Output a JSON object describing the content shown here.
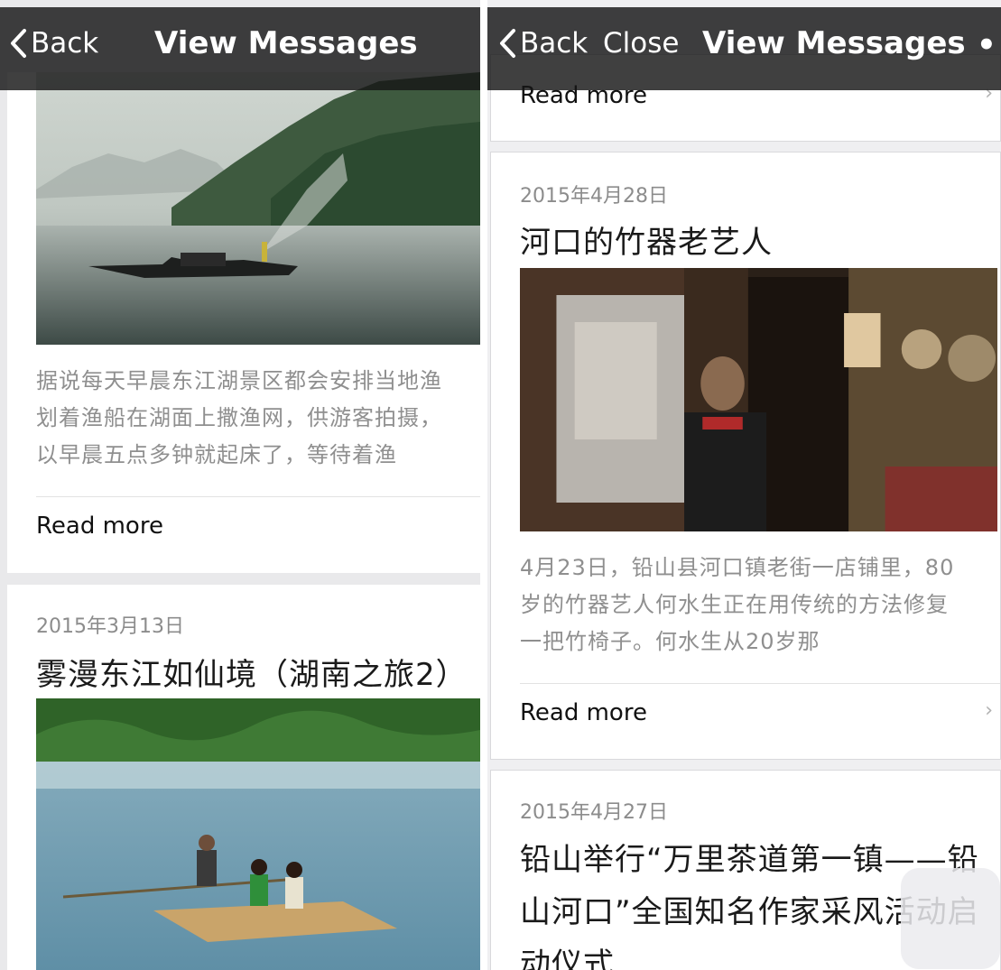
{
  "left": {
    "nav": {
      "back": "Back",
      "title": "View Messages"
    },
    "post1": {
      "excerpt": [
        "据说每天早晨东江湖景区都会安排当地渔",
        "划着渔船在湖面上撒渔网，供游客拍摄，",
        "以早晨五点多钟就起床了，等待着渔"
      ],
      "read_more": "Read more"
    },
    "post2": {
      "date": "2015年3月13日",
      "title": "雾漫东江如仙境（湖南之旅2）"
    }
  },
  "right": {
    "nav": {
      "back": "Back",
      "close": "Close",
      "title": "View Messages",
      "more": "••"
    },
    "top": {
      "read_more": "Read more",
      "chevron": "›"
    },
    "post1": {
      "date": "2015年4月28日",
      "title": "河口的竹器老艺人",
      "excerpt": [
        "4月23日，铅山县河口镇老街一店铺里，80",
        "岁的竹器艺人何水生正在用传统的方法修复",
        "一把竹椅子。何水生从20岁那"
      ],
      "read_more": "Read more",
      "chevron": "›"
    },
    "post2": {
      "date": "2015年4月27日",
      "title_lines": [
        "铅山举行“万里茶道第一镇——铅",
        "山河口”全国知名作家采风活动启",
        "动仪式"
      ]
    }
  }
}
